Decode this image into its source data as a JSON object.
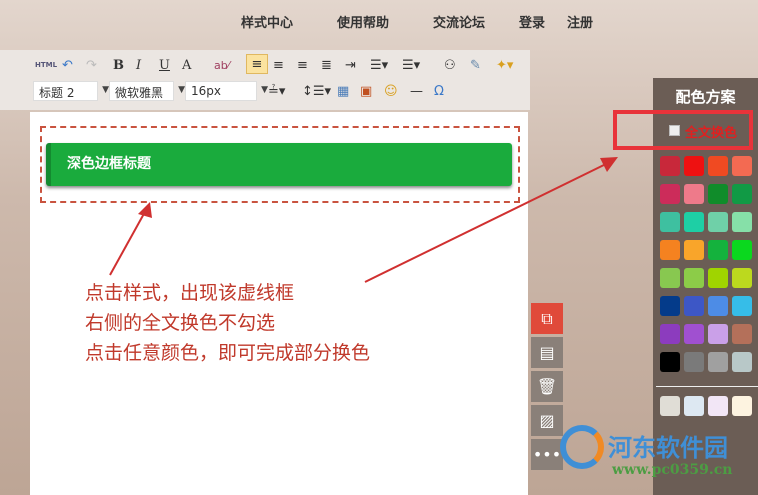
{
  "nav": [
    "样式中心",
    "使用帮助",
    "交流论坛",
    "登录",
    "注册"
  ],
  "toolbar": {
    "html": "HTML",
    "bold": "B",
    "italic": "I",
    "underline": "U",
    "fontcolor": "A",
    "heading": "标题 2",
    "font": "微软雅黑",
    "size": "16px",
    "omega": "Ω",
    "hr": "—"
  },
  "block_title": "深色边框标题",
  "notes": [
    "点击样式，出现该虚线框",
    "右侧的全文换色不勾选",
    "点击任意颜色，即可完成部分换色"
  ],
  "panel": {
    "title": "配色方案",
    "checkbox_label": "全文换色",
    "colors": [
      "#c8283a",
      "#ee1111",
      "#f04a22",
      "#f36a52",
      "#cc2c5a",
      "#ee7a8a",
      "#108c2a",
      "#119a45",
      "#3ec0a0",
      "#1ecfa5",
      "#6fd0a8",
      "#86e0a8",
      "#f58220",
      "#f9a52a",
      "#14b23d",
      "#0ad81e",
      "#88c850",
      "#8ccc48",
      "#a0d400",
      "#bcd91e",
      "#043b8a",
      "#3d57c6",
      "#4d8ce6",
      "#36bde8",
      "#8c3cbe",
      "#a050d0",
      "#caa0e8",
      "#b4705a",
      "#000000",
      "#7a7a7a",
      "#a0a0a0",
      "#b8c8c8",
      "#e0ddd6",
      "#dde8f2",
      "#f2e6f6",
      "#fdf3e0"
    ]
  },
  "watermark": {
    "name": "河东软件园",
    "url": "www.pc0359.cn"
  }
}
